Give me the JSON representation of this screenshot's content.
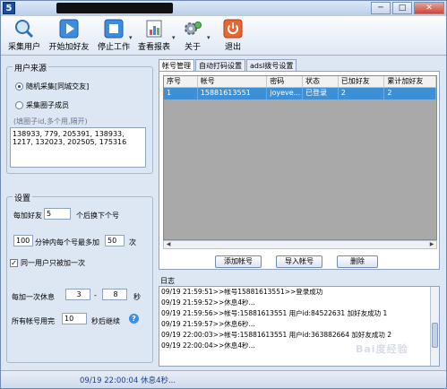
{
  "titlebar": {
    "app_icon_text": "5",
    "minimize": "─",
    "maximize": "□",
    "close": "✕"
  },
  "toolbar": {
    "items": [
      {
        "label": "采集用户",
        "icon": "magnifier-icon"
      },
      {
        "label": "开始加好友",
        "icon": "play-icon"
      },
      {
        "label": "停止工作",
        "icon": "stop-icon"
      },
      {
        "label": "查看报表",
        "icon": "report-icon"
      },
      {
        "label": "关于",
        "icon": "gear-icon"
      },
      {
        "label": "退出",
        "icon": "power-icon"
      }
    ],
    "dropdown_arrow": "▾"
  },
  "source_group": {
    "title": "用户来源",
    "option_random": "随机采集[同城交友]",
    "option_circle": "采集圈子成员",
    "hint": "(填圈子id,多个用,隔开)",
    "circle_ids": "138933, 779, 205391, 138933, 1217, 132023, 202505, 175316"
  },
  "settings_group": {
    "title": "设置",
    "add_prefix": "每加好友",
    "add_count": "5",
    "add_suffix": "个后换下个号",
    "minutes_value": "100",
    "minutes_mid": "分钟内每个号最多加",
    "max_add": "50",
    "times_unit": "次",
    "same_user_label": "同一用户只被加一次",
    "same_user_checked": "✓",
    "rest_prefix": "每加一次休息",
    "rest_min": "3",
    "rest_dash": "-",
    "rest_max": "8",
    "rest_unit": "秒",
    "all_done_prefix": "所有帐号用完",
    "all_done_value": "10",
    "all_done_suffix": "秒后继续",
    "help_icon": "?"
  },
  "tabs": [
    {
      "label": "帐号管理",
      "active": true
    },
    {
      "label": "自动打码设置",
      "active": false
    },
    {
      "label": "adsl拨号设置",
      "active": false
    }
  ],
  "accounts_table": {
    "columns": [
      "序号",
      "帐号",
      "密码",
      "状态",
      "已加好友",
      "累计加好友"
    ],
    "rows": [
      [
        "1",
        "15881613551",
        "joyeve...",
        "已登录",
        "2",
        "2"
      ]
    ]
  },
  "buttons": {
    "add_account": "添加帐号",
    "import_account": "导入帐号",
    "delete": "删除"
  },
  "log": {
    "title": "日志",
    "lines": [
      "09/19 21:59:51>>帐号15881613551>>登录成功",
      "09/19 21:59:52>>休息4秒...",
      "09/19 21:59:56>>帐号:15881613551 用户id:84522631 加好友成功 1",
      "09/19 21:59:57>>休息6秒...",
      "09/19 22:00:03>>帐号:15881613551 用户id:363882664 加好友成功 2",
      "09/19 22:00:04>>休息4秒..."
    ]
  },
  "status": {
    "text": "09/19 22:00:04 休息4秒..."
  },
  "watermark": "Bai度经验"
}
